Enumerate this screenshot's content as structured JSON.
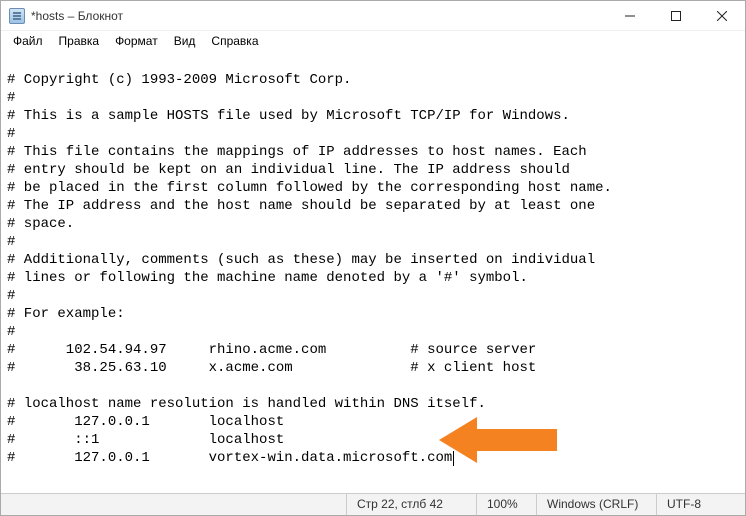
{
  "window": {
    "title": "*hosts – Блокнот"
  },
  "menu": {
    "file": "Файл",
    "edit": "Правка",
    "format": "Формат",
    "view": "Вид",
    "help": "Справка"
  },
  "content": {
    "lines": [
      "# Copyright (c) 1993-2009 Microsoft Corp.",
      "#",
      "# This is a sample HOSTS file used by Microsoft TCP/IP for Windows.",
      "#",
      "# This file contains the mappings of IP addresses to host names. Each",
      "# entry should be kept on an individual line. The IP address should",
      "# be placed in the first column followed by the corresponding host name.",
      "# The IP address and the host name should be separated by at least one",
      "# space.",
      "#",
      "# Additionally, comments (such as these) may be inserted on individual",
      "# lines or following the machine name denoted by a '#' symbol.",
      "#",
      "# For example:",
      "#",
      "#      102.54.94.97     rhino.acme.com          # source server",
      "#       38.25.63.10     x.acme.com              # x client host",
      "",
      "# localhost name resolution is handled within DNS itself.",
      "#       127.0.0.1       localhost",
      "#       ::1             localhost",
      "#       127.0.0.1       vortex-win.data.microsoft.com"
    ]
  },
  "status": {
    "position": "Стр 22, стлб 42",
    "zoom": "100%",
    "line_ending": "Windows (CRLF)",
    "encoding": "UTF-8"
  },
  "annotation": {
    "arrow_color": "#f58220"
  }
}
